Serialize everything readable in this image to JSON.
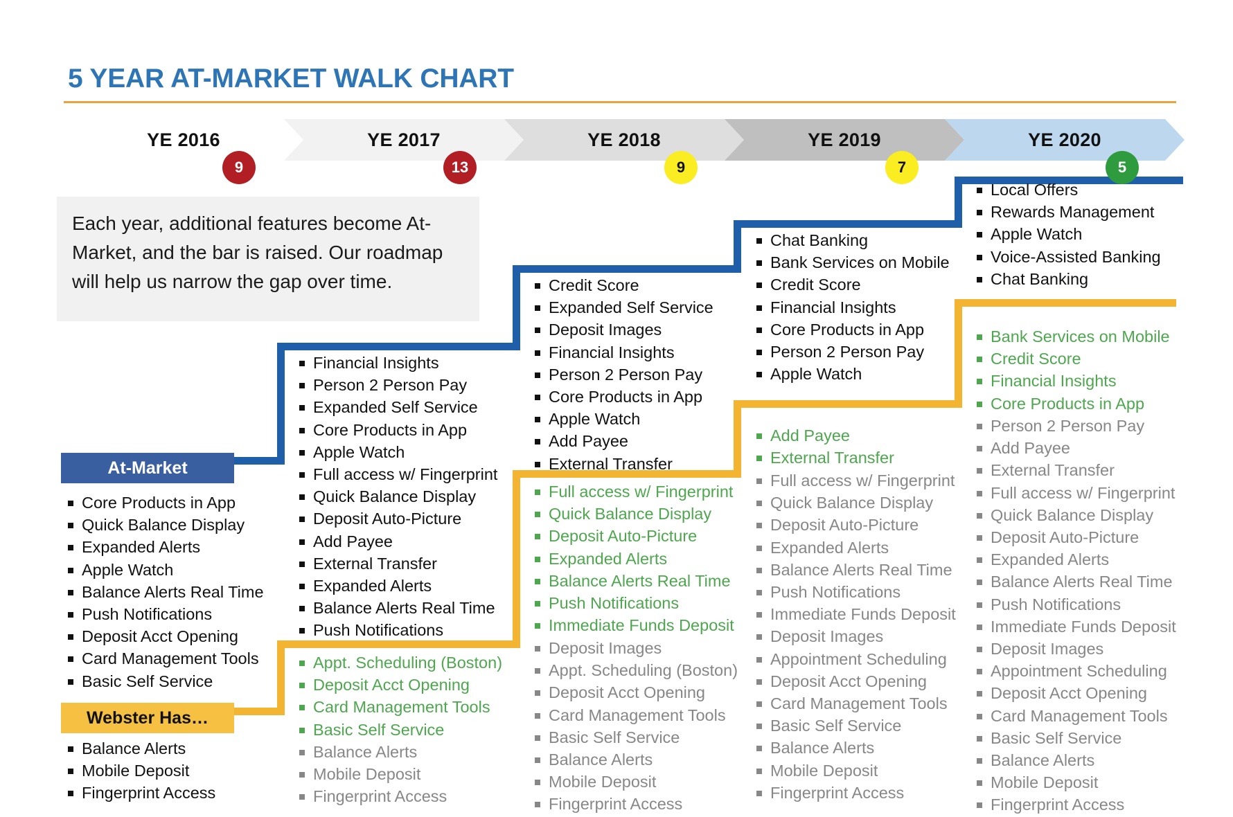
{
  "title": "5 YEAR AT-MARKET WALK CHART",
  "colors": {
    "title_blue": "#2E75B6",
    "rule_orange": "#E8A33D",
    "step_blue": "#1F5FA9",
    "step_yellow": "#F2B431",
    "at_market_label_bg": "#3A5FA0",
    "webster_label_bg": "#F6C043",
    "new_feature_green": "#4EA74E",
    "existing_feature_grey": "#878787",
    "badge_red": "#B11F24",
    "badge_yellow": "#FAED21",
    "badge_green": "#2E9B3F"
  },
  "years": [
    {
      "label": "YE 2016",
      "fill": "#FFFFFF"
    },
    {
      "label": "YE 2017",
      "fill": "#F2F2F2"
    },
    {
      "label": "YE 2018",
      "fill": "#DEDEDE"
    },
    {
      "label": "YE 2019",
      "fill": "#BFBFBF"
    },
    {
      "label": "YE 2020",
      "fill": "#BDD7EE"
    }
  ],
  "badges": [
    {
      "value": "9",
      "bg": "#B11F24",
      "fg": "#FFFFFF"
    },
    {
      "value": "13",
      "bg": "#B11F24",
      "fg": "#FFFFFF"
    },
    {
      "value": "9",
      "bg": "#FAED21",
      "fg": "#111111"
    },
    {
      "value": "7",
      "bg": "#FAED21",
      "fg": "#111111"
    },
    {
      "value": "5",
      "bg": "#2E9B3F",
      "fg": "#FFFFFF"
    }
  ],
  "intro": "Each year, additional features become At-Market, and the bar is raised.  Our roadmap will help us narrow the gap over time.",
  "labels": {
    "at_market": "At-Market",
    "webster_has": "Webster Has…"
  },
  "columns": {
    "y2016": {
      "at_market": [
        "Core Products in App",
        "Quick Balance Display",
        "Expanded Alerts",
        "Apple Watch",
        "Balance Alerts Real Time",
        "Push Notifications",
        "Deposit Acct Opening",
        "Card Management Tools",
        "Basic Self Service"
      ],
      "webster_has": [
        "Balance Alerts",
        "Mobile Deposit",
        "Fingerprint Access"
      ]
    },
    "y2017": {
      "at_market": [
        "Financial Insights",
        "Person 2 Person Pay",
        "Expanded Self Service",
        "Core Products in App",
        "Apple Watch",
        "Full access w/ Fingerprint",
        "Quick Balance Display",
        "Deposit Auto-Picture",
        "Add Payee",
        "External Transfer",
        "Expanded Alerts",
        "Balance Alerts Real Time",
        "Push Notifications"
      ],
      "webster_new": [
        "Appt. Scheduling (Boston)",
        "Deposit Acct Opening",
        "Card Management Tools",
        "Basic Self Service"
      ],
      "webster_existing": [
        "Balance Alerts",
        "Mobile Deposit",
        "Fingerprint Access"
      ]
    },
    "y2018": {
      "at_market": [
        "Credit Score",
        "Expanded Self Service",
        "Deposit Images",
        "Financial Insights",
        "Person 2 Person Pay",
        "Core Products in App",
        "Apple Watch",
        "Add Payee",
        "External Transfer"
      ],
      "webster_new": [
        "Full access w/ Fingerprint",
        "Quick Balance Display",
        "Deposit Auto-Picture",
        "Expanded Alerts",
        "Balance Alerts Real Time",
        "Push Notifications",
        "Immediate Funds Deposit"
      ],
      "webster_existing": [
        "Deposit Images",
        "Appt. Scheduling (Boston)",
        "Deposit Acct Opening",
        "Card Management Tools",
        "Basic Self Service",
        "Balance Alerts",
        "Mobile Deposit",
        "Fingerprint Access"
      ]
    },
    "y2019": {
      "at_market": [
        "Chat Banking",
        "Bank Services on Mobile",
        "Credit Score",
        "Financial Insights",
        "Core Products in App",
        "Person 2 Person Pay",
        "Apple Watch"
      ],
      "webster_new": [
        "Add Payee",
        "External Transfer"
      ],
      "webster_existing": [
        "Full access w/ Fingerprint",
        "Quick Balance Display",
        "Deposit Auto-Picture",
        "Expanded Alerts",
        "Balance Alerts Real Time",
        "Push Notifications",
        "Immediate Funds Deposit",
        "Deposit Images",
        "Appointment Scheduling",
        "Deposit Acct Opening",
        "Card Management Tools",
        "Basic Self Service",
        "Balance Alerts",
        "Mobile Deposit",
        "Fingerprint Access"
      ]
    },
    "y2020": {
      "at_market": [
        "Local Offers",
        "Rewards Management",
        "Apple Watch",
        "Voice-Assisted Banking",
        "Chat Banking"
      ],
      "webster_new": [
        "Bank Services on Mobile",
        "Credit Score",
        "Financial Insights",
        "Core Products in App"
      ],
      "webster_existing": [
        "Person 2 Person Pay",
        "Add Payee",
        "External Transfer",
        "Full access w/ Fingerprint",
        "Quick Balance Display",
        "Deposit Auto-Picture",
        "Expanded Alerts",
        "Balance Alerts Real Time",
        "Push Notifications",
        "Immediate Funds Deposit",
        "Deposit Images",
        "Appointment Scheduling",
        "Deposit Acct Opening",
        "Card Management Tools",
        "Basic Self Service",
        "Balance Alerts",
        "Mobile Deposit",
        "Fingerprint Access"
      ]
    }
  }
}
